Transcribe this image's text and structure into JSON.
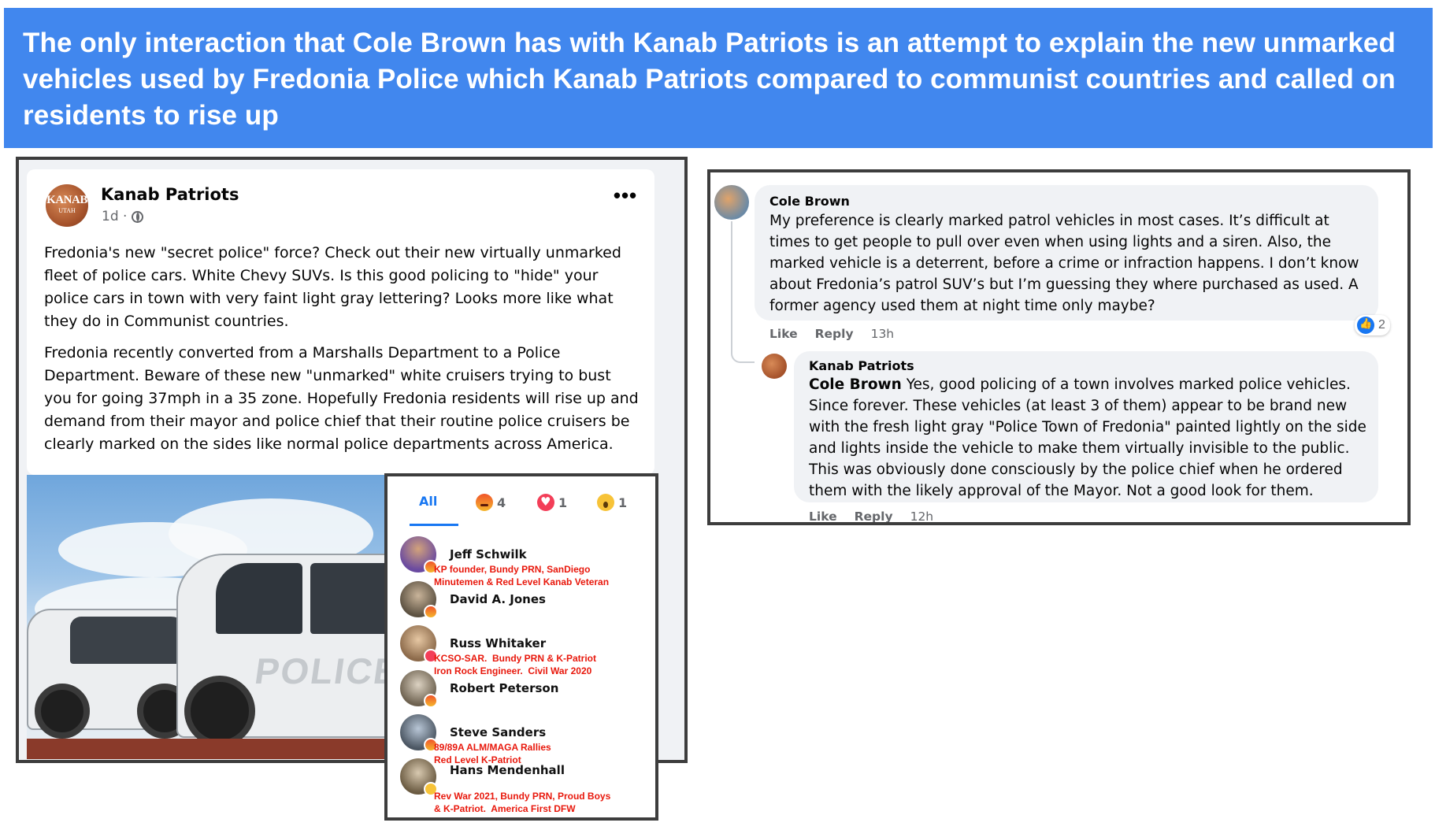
{
  "banner": {
    "text": "The only interaction that Cole Brown has with Kanab Patriots is an attempt to explain the new unmarked vehicles used by Fredonia Police which Kanab Patriots compared to communist countries and called on residents to rise up"
  },
  "post": {
    "avatar_text_big": "KANAB",
    "avatar_text_small": "UTAH",
    "author": "Kanab Patriots",
    "time": "1d ·",
    "more_label": "•••",
    "paragraph1": "Fredonia's new \"secret police\" force?  Check out their new virtually unmarked fleet of police cars.  White Chevy SUVs.  Is this good policing to \"hide\" your police cars in town with very faint light gray lettering?  Looks more like what they do in Communist countries.",
    "paragraph2": "Fredonia recently converted from a Marshalls Department to a Police Department.  Beware of these new \"unmarked\" white cruisers  trying to bust you for going 37mph in a 35 zone.  Hopefully Fredonia residents will rise up and demand from their mayor and police chief that their routine police cruisers be clearly marked on the sides like normal police departments across America.",
    "photo_label": "POLICE"
  },
  "reactions": {
    "tabs": [
      {
        "label": "All",
        "type": "all"
      },
      {
        "label": "4",
        "type": "angry"
      },
      {
        "label": "1",
        "type": "love"
      },
      {
        "label": "1",
        "type": "wow"
      }
    ],
    "people": [
      {
        "name": "Jeff Schwilk",
        "reaction": "angry",
        "note": "KP founder, Bundy PRN, SanDiego\nMinutemen & Red Level Kanab Veteran"
      },
      {
        "name": "David A. Jones",
        "reaction": "angry",
        "note": ""
      },
      {
        "name": "Russ Whitaker",
        "reaction": "love",
        "note": "KCSO-SAR.  Bundy PRN & K-Patriot\nIron Rock Engineer.  Civil War 2020"
      },
      {
        "name": "Robert Peterson",
        "reaction": "angry",
        "note": ""
      },
      {
        "name": "Steve Sanders",
        "reaction": "angry",
        "note": "89/89A ALM/MAGA Rallies\nRed Level K-Patriot"
      },
      {
        "name": "Hans Mendenhall",
        "reaction": "wow",
        "note": "Rev War 2021, Bundy PRN, Proud Boys\n& K-Patriot.  America First DFW"
      }
    ]
  },
  "comments": [
    {
      "name": "Cole Brown",
      "text": "My preference is clearly marked patrol vehicles in most cases. It’s difficult at times to get people to pull over even when using lights and a siren. Also, the marked vehicle is a deterrent, before a crime or infraction happens. I don’t know about Fredonia’s patrol SUV’s but I’m guessing they where purchased as used. A former agency used them at night time only maybe?",
      "like": "Like",
      "reply": "Reply",
      "time": "13h",
      "like_count": "2"
    },
    {
      "name": "Kanab Patriots",
      "mention": "Cole Brown",
      "text": " Yes, good policing of a town involves marked police vehicles. Since forever. These vehicles (at least 3 of them) appear to be brand new with the fresh light gray \"Police Town of Fredonia\" painted lightly on the side and lights inside the vehicle to make them virtually invisible to the public. This was obviously done consciously by the police chief when he ordered them with the likely approval of the Mayor. Not a good look for them.",
      "like": "Like",
      "reply": "Reply",
      "time": "12h"
    }
  ],
  "colors": {
    "banner": "#4187ee",
    "fb_blue": "#1877f2",
    "annotation_red": "#e8180c"
  }
}
